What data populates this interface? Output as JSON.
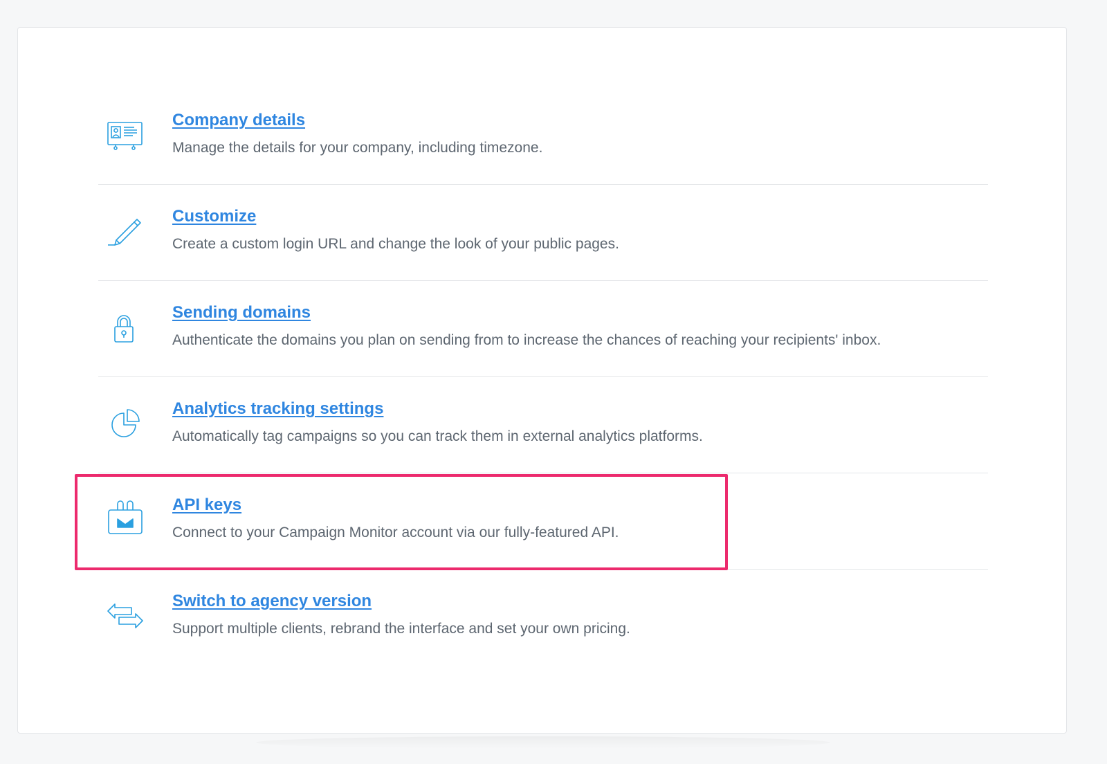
{
  "colors": {
    "link": "#2f86e0",
    "description": "#5d6670",
    "icon": "#2ba0e0",
    "highlight": "#ec2a6d",
    "divider": "#e3e5e8"
  },
  "items": [
    {
      "icon": "id-card-icon",
      "title": "Company details",
      "description": "Manage the details for your company, including timezone."
    },
    {
      "icon": "pencil-icon",
      "title": "Customize",
      "description": "Create a custom login URL and change the look of your public pages."
    },
    {
      "icon": "lock-icon",
      "title": "Sending domains",
      "description": "Authenticate the domains you plan on sending from to increase the chances of reaching your recipients' inbox."
    },
    {
      "icon": "pie-chart-icon",
      "title": "Analytics tracking settings",
      "description": "Automatically tag campaigns so you can track them in external analytics platforms."
    },
    {
      "icon": "api-plug-icon",
      "title": "API keys",
      "description": "Connect to your Campaign Monitor account via our fully-featured API.",
      "highlighted": true
    },
    {
      "icon": "switch-arrows-icon",
      "title": "Switch to agency version",
      "description": "Support multiple clients, rebrand the interface and set your own pricing."
    }
  ]
}
